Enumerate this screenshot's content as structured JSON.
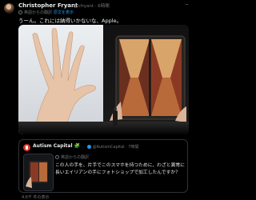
{
  "tweet": {
    "author_name": "Christopher Fryant",
    "author_handle": "@cfryant",
    "time": "· 6時間",
    "translated_label": "英語からの翻訳",
    "show_original": "原文を表示",
    "text": "うーん。これには納得いかないな、Apple。"
  },
  "quote": {
    "author_name": "Autism Capital 🧩",
    "author_handle": "@AutismCapital · 7時間",
    "translated_label": "英語からの翻訳",
    "text": "この人の手を、片手でこのスマホを持つために、わざと異常に長いエイリアンの手にフォトショップで加工したんですか？"
  },
  "footer": "4.6千 件の表示",
  "colors": {
    "accent": "#1d9bf0",
    "muted": "#71767b",
    "text": "#e7e9ea",
    "border": "#2f3336"
  }
}
